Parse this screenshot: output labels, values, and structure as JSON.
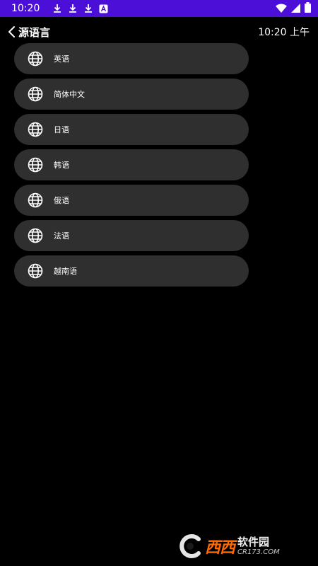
{
  "status_bar": {
    "time": "10:20",
    "bg_color": "#4b0fd8",
    "left_icons": [
      "download-icon",
      "download-icon",
      "download-icon",
      "a-badge-icon"
    ],
    "right_icons": [
      "wifi-icon",
      "signal-icon",
      "battery-icon"
    ]
  },
  "header": {
    "back_icon": "chevron-left-icon",
    "title": "源语言",
    "clock": "10:20 上午"
  },
  "languages": [
    {
      "label": "英语",
      "icon": "globe-icon"
    },
    {
      "label": "简体中文",
      "icon": "globe-icon"
    },
    {
      "label": "日语",
      "icon": "globe-icon"
    },
    {
      "label": "韩语",
      "icon": "globe-icon"
    },
    {
      "label": "俄语",
      "icon": "globe-icon"
    },
    {
      "label": "法语",
      "icon": "globe-icon"
    },
    {
      "label": "越南语",
      "icon": "globe-icon"
    }
  ],
  "watermark": {
    "brand": "西西",
    "name": "软件园",
    "url": "CR173.COM"
  },
  "colors": {
    "background": "#000000",
    "item_bg": "#2f2f2f",
    "text": "#ffffff"
  }
}
